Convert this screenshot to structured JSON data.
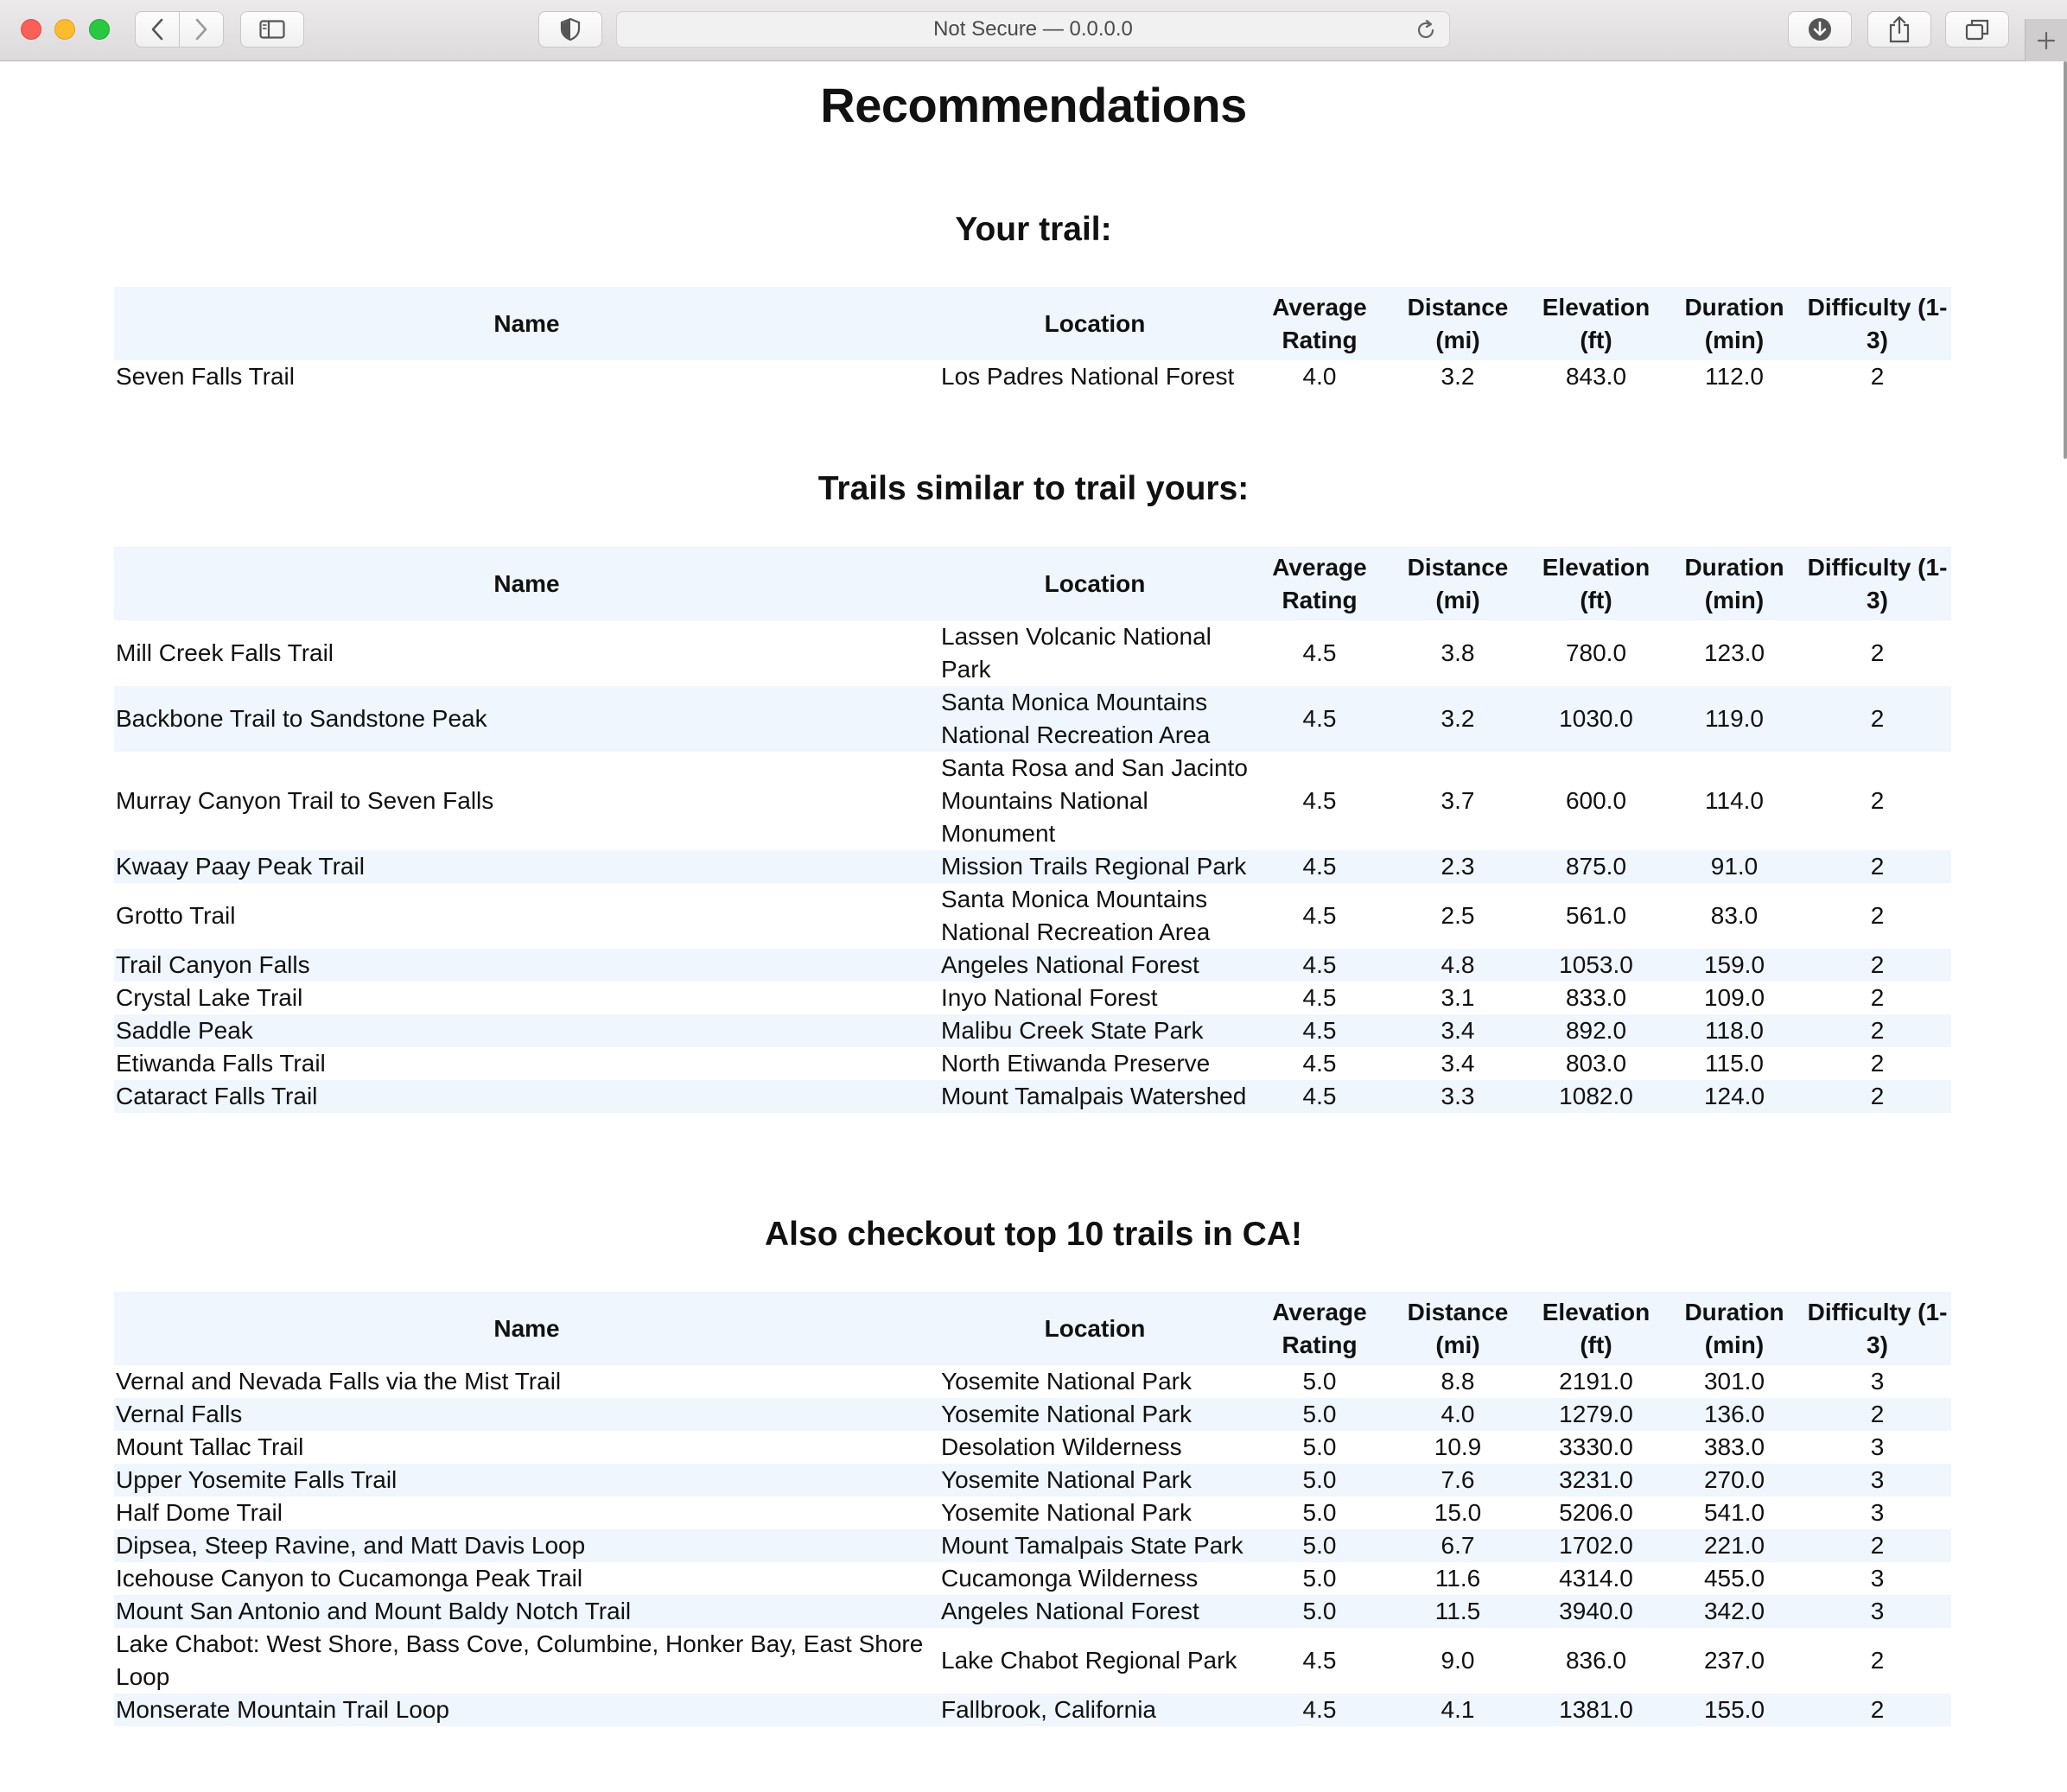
{
  "browser": {
    "url_text": "Not Secure — 0.0.0.0"
  },
  "page": {
    "title": "Recommendations"
  },
  "headers": {
    "name": "Name",
    "location": "Location",
    "rating": "Average Rating",
    "distance": "Distance (mi)",
    "elevation": "Elevation (ft)",
    "duration": "Duration (min)",
    "difficulty": "Difficulty (1-3)"
  },
  "sections": [
    {
      "heading": "Your trail:",
      "rows": [
        {
          "name": "Seven Falls Trail",
          "location": "Los Padres National Forest",
          "rating": "4.0",
          "distance": "3.2",
          "elevation": "843.0",
          "duration": "112.0",
          "difficulty": "2"
        }
      ]
    },
    {
      "heading": "Trails similar to trail yours:",
      "rows": [
        {
          "name": "Mill Creek Falls Trail",
          "location": "Lassen Volcanic National Park",
          "rating": "4.5",
          "distance": "3.8",
          "elevation": "780.0",
          "duration": "123.0",
          "difficulty": "2"
        },
        {
          "name": "Backbone Trail to Sandstone Peak",
          "location": "Santa Monica Mountains National Recreation Area",
          "rating": "4.5",
          "distance": "3.2",
          "elevation": "1030.0",
          "duration": "119.0",
          "difficulty": "2"
        },
        {
          "name": "Murray Canyon Trail to Seven Falls",
          "location": "Santa Rosa and San Jacinto Mountains National Monument",
          "rating": "4.5",
          "distance": "3.7",
          "elevation": "600.0",
          "duration": "114.0",
          "difficulty": "2"
        },
        {
          "name": "Kwaay Paay Peak Trail",
          "location": "Mission Trails Regional Park",
          "rating": "4.5",
          "distance": "2.3",
          "elevation": "875.0",
          "duration": "91.0",
          "difficulty": "2"
        },
        {
          "name": "Grotto Trail",
          "location": "Santa Monica Mountains National Recreation Area",
          "rating": "4.5",
          "distance": "2.5",
          "elevation": "561.0",
          "duration": "83.0",
          "difficulty": "2"
        },
        {
          "name": "Trail Canyon Falls",
          "location": "Angeles National Forest",
          "rating": "4.5",
          "distance": "4.8",
          "elevation": "1053.0",
          "duration": "159.0",
          "difficulty": "2"
        },
        {
          "name": "Crystal Lake Trail",
          "location": "Inyo National Forest",
          "rating": "4.5",
          "distance": "3.1",
          "elevation": "833.0",
          "duration": "109.0",
          "difficulty": "2"
        },
        {
          "name": "Saddle Peak",
          "location": "Malibu Creek State Park",
          "rating": "4.5",
          "distance": "3.4",
          "elevation": "892.0",
          "duration": "118.0",
          "difficulty": "2"
        },
        {
          "name": "Etiwanda Falls Trail",
          "location": "North Etiwanda Preserve",
          "rating": "4.5",
          "distance": "3.4",
          "elevation": "803.0",
          "duration": "115.0",
          "difficulty": "2"
        },
        {
          "name": "Cataract Falls Trail",
          "location": "Mount Tamalpais Watershed",
          "rating": "4.5",
          "distance": "3.3",
          "elevation": "1082.0",
          "duration": "124.0",
          "difficulty": "2"
        }
      ]
    },
    {
      "heading": "Also checkout top 10 trails in CA!",
      "rows": [
        {
          "name": "Vernal and Nevada Falls via the Mist Trail",
          "location": "Yosemite National Park",
          "rating": "5.0",
          "distance": "8.8",
          "elevation": "2191.0",
          "duration": "301.0",
          "difficulty": "3"
        },
        {
          "name": "Vernal Falls",
          "location": "Yosemite National Park",
          "rating": "5.0",
          "distance": "4.0",
          "elevation": "1279.0",
          "duration": "136.0",
          "difficulty": "2"
        },
        {
          "name": "Mount Tallac Trail",
          "location": "Desolation Wilderness",
          "rating": "5.0",
          "distance": "10.9",
          "elevation": "3330.0",
          "duration": "383.0",
          "difficulty": "3"
        },
        {
          "name": "Upper Yosemite Falls Trail",
          "location": "Yosemite National Park",
          "rating": "5.0",
          "distance": "7.6",
          "elevation": "3231.0",
          "duration": "270.0",
          "difficulty": "3"
        },
        {
          "name": "Half Dome Trail",
          "location": "Yosemite National Park",
          "rating": "5.0",
          "distance": "15.0",
          "elevation": "5206.0",
          "duration": "541.0",
          "difficulty": "3"
        },
        {
          "name": "Dipsea, Steep Ravine, and Matt Davis Loop",
          "location": "Mount Tamalpais State Park",
          "rating": "5.0",
          "distance": "6.7",
          "elevation": "1702.0",
          "duration": "221.0",
          "difficulty": "2"
        },
        {
          "name": "Icehouse Canyon to Cucamonga Peak Trail",
          "location": "Cucamonga Wilderness",
          "rating": "5.0",
          "distance": "11.6",
          "elevation": "4314.0",
          "duration": "455.0",
          "difficulty": "3"
        },
        {
          "name": "Mount San Antonio and Mount Baldy Notch Trail",
          "location": "Angeles National Forest",
          "rating": "5.0",
          "distance": "11.5",
          "elevation": "3940.0",
          "duration": "342.0",
          "difficulty": "3"
        },
        {
          "name": "Lake Chabot: West Shore, Bass Cove, Columbine, Honker Bay, East Shore Loop",
          "location": "Lake Chabot Regional Park",
          "rating": "4.5",
          "distance": "9.0",
          "elevation": "836.0",
          "duration": "237.0",
          "difficulty": "2"
        },
        {
          "name": "Monserate Mountain Trail Loop",
          "location": "Fallbrook, California",
          "rating": "4.5",
          "distance": "4.1",
          "elevation": "1381.0",
          "duration": "155.0",
          "difficulty": "2"
        }
      ]
    }
  ]
}
